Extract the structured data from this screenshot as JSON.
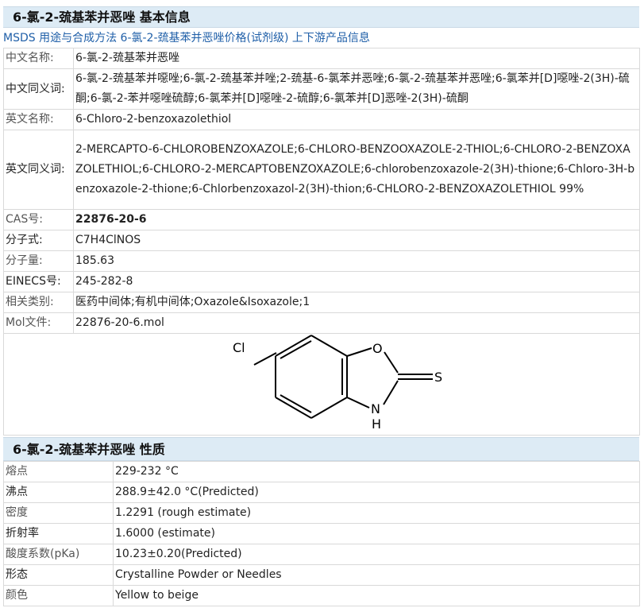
{
  "basic": {
    "title": "6-氯-2-巯基苯并恶唑 基本信息",
    "links": [
      "MSDS",
      "用途与合成方法",
      "6-氯-2-巯基苯并恶唑价格(试剂级)",
      "上下游产品信息"
    ],
    "rows": {
      "cn_name": {
        "label": "中文名称:",
        "value": "6-氯-2-巯基苯并恶唑"
      },
      "cn_syn": {
        "label": "中文同义词:",
        "value": "6-氯-2-巯基苯并噁唑;6-氯-2-巯基苯并唑;2-巯基-6-氯苯并恶唑;6-氯-2-巯基苯并恶唑;6-氯苯并[D]噁唑-2(3H)-硫酮;6-氯-2-苯并噁唑硫醇;6-氯苯并[D]噁唑-2-硫醇;6-氯苯并[D]恶唑-2(3H)-硫酮"
      },
      "en_name": {
        "label": "英文名称:",
        "value": "6-Chloro-2-benzoxazolethiol"
      },
      "en_syn": {
        "label": "英文同义词:",
        "value": "2-MERCAPTO-6-CHLOROBENZOXAZOLE;6-CHLORO-BENZOOXAZOLE-2-THIOL;6-CHLORO-2-BENZOXAZOLETHIOL;6-CHLORO-2-MERCAPTOBENZOXAZOLE;6-chlorobenzoxazole-2(3H)-thione;6-Chloro-3H-benzoxazole-2-thione;6-Chlorbenzoxazol-2(3H)-thion;6-CHLORO-2-BENZOXAZOLETHIOL 99%"
      },
      "cas": {
        "label": "CAS号:",
        "value": "22876-20-6"
      },
      "formula": {
        "label": "分子式:",
        "value": "C7H4ClNOS"
      },
      "mw": {
        "label": "分子量:",
        "value": "185.63"
      },
      "einecs": {
        "label": "EINECS号:",
        "value": "245-282-8"
      },
      "category": {
        "label": "相关类别:",
        "value": "医药中间体;有机中间体;Oxazole&Isoxazole;1"
      },
      "mol": {
        "label": "Mol文件:",
        "value": "22876-20-6.mol"
      }
    },
    "structure_atoms": {
      "cl": "Cl",
      "o": "O",
      "s": "S",
      "nh": "N",
      "h": "H"
    }
  },
  "props": {
    "title": "6-氯-2-巯基苯并恶唑 性质",
    "rows": [
      {
        "label": "熔点",
        "value": "229-232 °C"
      },
      {
        "label": "沸点",
        "value": "288.9±42.0 °C(Predicted)"
      },
      {
        "label": "密度",
        "value": "1.2291 (rough estimate)"
      },
      {
        "label": "折射率",
        "value": "1.6000 (estimate)"
      },
      {
        "label": "酸度系数(pKa)",
        "value": "10.23±0.20(Predicted)"
      },
      {
        "label": "形态",
        "value": "Crystalline Powder or Needles"
      },
      {
        "label": "颜色",
        "value": "Yellow to beige"
      }
    ]
  }
}
